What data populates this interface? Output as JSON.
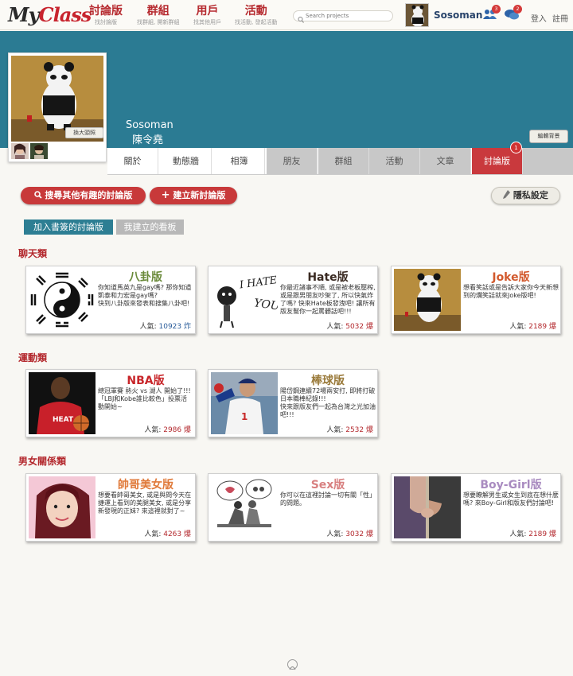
{
  "header": {
    "logo_my": "My",
    "logo_class": "Class",
    "nav": [
      {
        "label": "討論版",
        "sub": "找討論版"
      },
      {
        "label": "群組",
        "sub": "找群組, 開新群組"
      },
      {
        "label": "用戶",
        "sub": "找其他用戶"
      },
      {
        "label": "活動",
        "sub": "找活動, 發起活動"
      }
    ],
    "search_placeholder": "Search projects",
    "username": "Sosoman",
    "friend_badge": "3",
    "message_badge": "2",
    "login": "登入",
    "register": "註冊"
  },
  "profile": {
    "name_en": "Sosoman",
    "name_zh": "陳令堯",
    "enlarge": "換大頭照",
    "edit_bg": "編輯背景"
  },
  "tabs": [
    {
      "label": "關於"
    },
    {
      "label": "動態牆"
    },
    {
      "label": "相簿"
    },
    {
      "label": "朋友"
    },
    {
      "label": "群組"
    },
    {
      "label": "活動"
    },
    {
      "label": "文章"
    },
    {
      "label": "討論版",
      "badge": "1"
    }
  ],
  "actions": {
    "search_boards": "搜尋其他有趣的討論版",
    "create_board": "建立新討論版",
    "privacy": "隱私設定"
  },
  "subtabs": {
    "bookmarked": "加入書簽的討論版",
    "created": "我建立的看板"
  },
  "categories": [
    {
      "title": "聊天類",
      "boards": [
        {
          "title": "八卦版",
          "title_color": "#6a8a3a",
          "desc": "你知道馬英九是gay嗎? 那你知道凱泰和力宏是gay嗎?\n快到八卦版來發表和搜集八卦吧!",
          "pop_label": "人氣:",
          "pop_value": "10923 炸"
        },
        {
          "title": "Hate版",
          "title_color": "#3a2a22",
          "desc": "你最近諸事不順, 或是被老板壓榨, 或是跟男朋友吵架了, 所以快氣炸了嗎? 快來Hate板發洩吧! 讓所有版友幫你一起罵髒話吧!!!",
          "pop_label": "人氣:",
          "pop_value": "5032 爆"
        },
        {
          "title": "Joke版",
          "title_color": "#d2592d",
          "desc": "想看笑話或是告訴大家你今天新想到的爛笑話就來Joke版吧!",
          "pop_label": "人氣:",
          "pop_value": "2189 爆"
        }
      ]
    },
    {
      "title": "運動類",
      "boards": [
        {
          "title": "NBA版",
          "title_color": "#c8262a",
          "desc": "總冠軍賽 熱火 vs 湖人 開始了!!!\n「LBJ和Kobe誰比較色」投票活動開始~",
          "pop_label": "人氣:",
          "pop_value": "2986 爆"
        },
        {
          "title": "棒球版",
          "title_color": "#9a7a3a",
          "desc": "陽岱鋼連續72場兩安打, 即將打破日本職棒紀錄!!!\n快來跟版友們一起為台灣之光加油吧!!!",
          "pop_label": "人氣:",
          "pop_value": "2532 爆"
        }
      ]
    },
    {
      "title": "男女關係類",
      "boards": [
        {
          "title": "帥哥美女版",
          "title_color": "#e07a3a",
          "desc": "想要看帥哥美女, 或是與問今天在捷運上看到的美腿美女, 或是分享新發現的正妹? 來這裡就對了~",
          "pop_label": "人氣:",
          "pop_value": "4263 爆"
        },
        {
          "title": "Sex版",
          "title_color": "#d88080",
          "desc": "你可以在這裡討論一切有關「性」的問題。",
          "pop_label": "人氣:",
          "pop_value": "3032 爆"
        },
        {
          "title": "Boy-Girl版",
          "title_color": "#a98bc0",
          "desc": "想要瞭解男生或女生到底在想什麼嗎? 來Boy-Girl和版友們討論吧!",
          "pop_label": "人氣:",
          "pop_value": "2189 爆"
        }
      ]
    }
  ]
}
